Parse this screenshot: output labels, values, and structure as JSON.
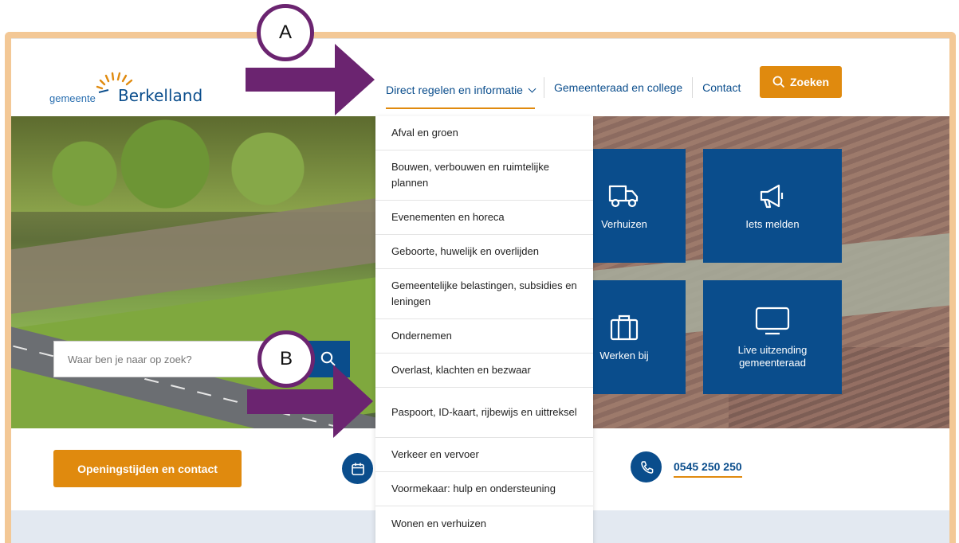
{
  "header": {
    "logo_small": "gemeente",
    "logo_big": "Berkelland",
    "nav": [
      {
        "label": "Direct regelen en informatie"
      },
      {
        "label": "Gemeenteraad en college"
      },
      {
        "label": "Contact"
      }
    ],
    "search_button": "Zoeken"
  },
  "hero": {
    "search_placeholder": "Waar ben je naar op zoek?",
    "tiles": [
      {
        "label": "Verhuizen",
        "icon": "truck-icon"
      },
      {
        "label": "Iets melden",
        "icon": "megaphone-icon"
      },
      {
        "label": "Werken bij",
        "icon": "briefcase-icon"
      },
      {
        "label": "Live uitzending gemeenteraad",
        "icon": "monitor-icon"
      }
    ]
  },
  "dropdown": {
    "items": [
      "Afval en groen",
      "Bouwen, verbouwen en ruimtelijke plannen",
      "Evenementen en horeca",
      "Geboorte, huwelijk en overlijden",
      "Gemeentelijke belastingen, subsidies en leningen",
      "Ondernemen",
      "Overlast, klachten en bezwaar",
      "Paspoort, ID-kaart, rijbewijs en uittreksel",
      "Verkeer en vervoer",
      "Voormekaar: hulp en ondersteuning",
      "Wonen en verhuizen"
    ]
  },
  "contact_strip": {
    "opening_button": "Openingstijden en contact",
    "phone": "0545 250 250"
  },
  "annotations": {
    "a": "A",
    "b": "B"
  },
  "colors": {
    "brand_blue": "#0a4d8c",
    "accent_orange": "#e08a0e",
    "frame": "#f3c896",
    "annotation_purple": "#6b2470"
  }
}
